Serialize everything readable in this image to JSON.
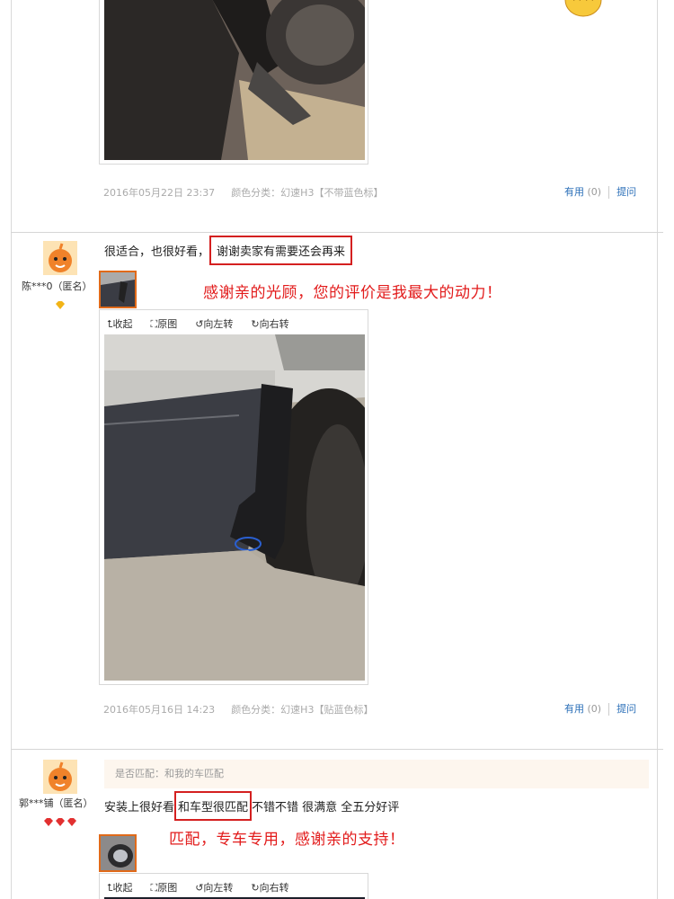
{
  "reviews": [
    {
      "date": "2016年05月22日 23:37",
      "spec": "颜色分类：幻速H3【不带蓝色标】",
      "useful_label": "有用",
      "useful_count": "(0)",
      "ask_label": "提问"
    },
    {
      "username": "陈***0（匿名）",
      "text_before": "很适合，也很好看，",
      "text_highlight": "谢谢卖家有需要还会再来",
      "seller_reply": "感谢亲的光顾，您的评价是我最大的动力！",
      "toolbar": [
        "收起",
        "原图",
        "向左转",
        "向右转"
      ],
      "date": "2016年05月16日 14:23",
      "spec": "颜色分类：幻速H3【贴蓝色标】",
      "useful_label": "有用",
      "useful_count": "(0)",
      "ask_label": "提问"
    },
    {
      "username": "郭***铺（匿名）",
      "match_label": "是否匹配：和我的车匹配",
      "text_before": "安装上很好看",
      "text_highlight": "和车型很匹配",
      "text_after": "不错不错 很满意 全五分好评",
      "seller_reply": "匹配，专车专用，感谢亲的支持！",
      "toolbar": [
        "收起",
        "原图",
        "向左转",
        "向右转"
      ]
    }
  ],
  "colors": {
    "accent_red": "#e21b1b",
    "link_blue": "#2b6fb8",
    "avatar_orange": "#f6b94d"
  }
}
